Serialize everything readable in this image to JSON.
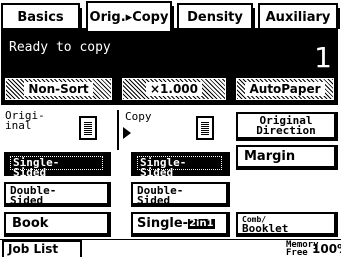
{
  "tabs": [
    {
      "label": "Basics"
    },
    {
      "label": "Orig.▸Copy"
    },
    {
      "label": "Density"
    },
    {
      "label": "Auxiliary"
    }
  ],
  "status": {
    "message": "Ready to copy",
    "count": "1"
  },
  "top_buttons": {
    "sort": "Non-Sort",
    "zoom": "×1.000",
    "paper": "AutoPaper"
  },
  "original": {
    "label_line1": "Origi-",
    "label_line2": "inal",
    "single_line1": "Single-",
    "single_line2": "Sided",
    "double_line1": "Double-",
    "double_line2": "Sided",
    "book": "Book"
  },
  "copy": {
    "label": "Copy",
    "single_line1": "Single-",
    "single_line2": "Sided",
    "double_line1": "Double-",
    "double_line2": "Sided",
    "single_combine": "Single-",
    "single_combine_badge": "2in1"
  },
  "right": {
    "orig_dir_line1": "Original",
    "orig_dir_line2": "Direction",
    "margin": "Margin",
    "booklet_line1": "Comb/",
    "booklet_line2": "Booklet"
  },
  "footer": {
    "job_list": "Job List",
    "memory_line1": "Memory",
    "memory_line2": "Free",
    "memory_value": "100%"
  }
}
